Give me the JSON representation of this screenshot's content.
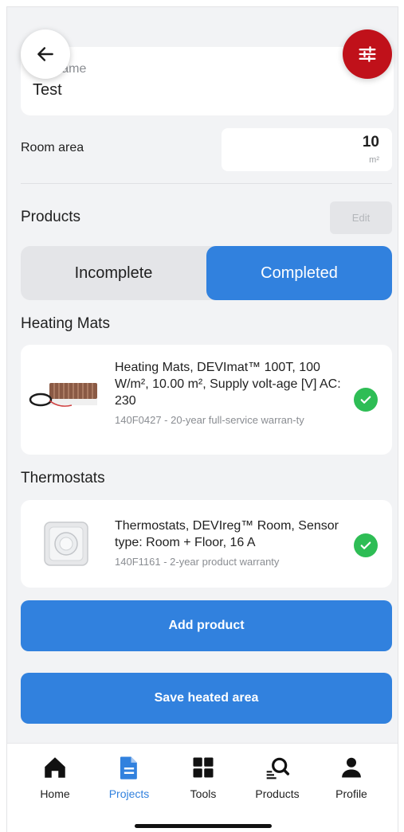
{
  "name_field": {
    "label": "n name",
    "value": "Test"
  },
  "room_area": {
    "label": "Room area",
    "value": "10",
    "unit": "m²"
  },
  "products": {
    "title": "Products",
    "edit_label": "Edit",
    "tabs": [
      {
        "label": "Incomplete",
        "selected": false
      },
      {
        "label": "Completed",
        "selected": true
      }
    ],
    "sections": [
      {
        "title": "Heating Mats",
        "item": {
          "title": "Heating Mats, DEVImat™ 100T, 100 W/m², 10.00 m², Supply volt-age [V] AC: 230",
          "subtitle": "140F0427 - 20-year full-service warran-ty",
          "status_icon": "check-circle-icon"
        }
      },
      {
        "title": "Thermostats",
        "item": {
          "title": "Thermostats, DEVIreg™ Room, Sensor type: Room + Floor, 16 A",
          "subtitle": "140F1161 - 2-year product warranty",
          "status_icon": "check-circle-icon"
        }
      }
    ]
  },
  "actions": {
    "add_product": "Add product",
    "save_heated_area": "Save heated area"
  },
  "bottom_nav": [
    {
      "label": "Home",
      "icon": "home-icon",
      "active": false
    },
    {
      "label": "Projects",
      "icon": "document-icon",
      "active": true
    },
    {
      "label": "Tools",
      "icon": "grid-icon",
      "active": false
    },
    {
      "label": "Products",
      "icon": "product-search-icon",
      "active": false
    },
    {
      "label": "Profile",
      "icon": "person-icon",
      "active": false
    }
  ],
  "colors": {
    "accent": "#3181de",
    "danger": "#c0111a",
    "success": "#2ebd55",
    "background": "#f2f3f5"
  }
}
